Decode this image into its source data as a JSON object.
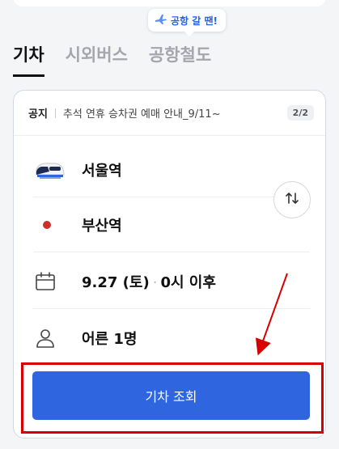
{
  "tooltip": {
    "text": "공항 갈 땐!",
    "icon": "airplane-icon"
  },
  "tabs": [
    {
      "label": "기차",
      "active": true
    },
    {
      "label": "시외버스",
      "active": false
    },
    {
      "label": "공항철도",
      "active": false
    }
  ],
  "notice": {
    "label": "공지",
    "text": "추석 연휴 승차권 예매 안내_9/11~",
    "page": "2/2"
  },
  "departure": {
    "station": "서울역",
    "icon": "train-icon"
  },
  "arrival": {
    "station": "부산역",
    "icon": "red-dot-icon"
  },
  "date": {
    "date": "9.27 (토)",
    "time": "0시 이후",
    "separator": "·",
    "icon": "calendar-icon"
  },
  "passengers": {
    "text": "어른 1명",
    "icon": "person-icon"
  },
  "search_button": {
    "label": "기차 조회"
  },
  "colors": {
    "accent": "#2f66e0",
    "annotation": "#d60000",
    "tooltip_text": "#2563eb"
  }
}
